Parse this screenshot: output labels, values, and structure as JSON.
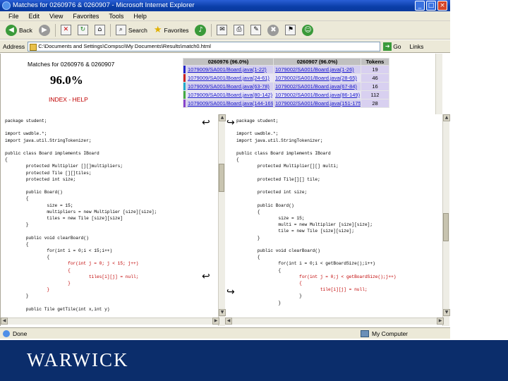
{
  "window": {
    "title": "Matches for 0260976 & 0260907 - Microsoft Internet Explorer",
    "controls": [
      "_",
      "□",
      "×"
    ]
  },
  "menu": [
    "File",
    "Edit",
    "View",
    "Favorites",
    "Tools",
    "Help"
  ],
  "toolbar": {
    "back": "Back",
    "search": "Search",
    "favorites": "Favorites"
  },
  "address": {
    "label": "Address",
    "value": "C:\\Documents and Settings\\Compsci\\My Documents\\Results\\match0.html",
    "go": "Go",
    "links": "Links"
  },
  "header": {
    "title": "Matches for 0260976 & 0260907",
    "percent": "96.0%",
    "index_link": "INDEX - HELP",
    "columns": [
      "0260976 (96.0%)",
      "0260907 (96.0%)",
      "Tokens"
    ],
    "rows": [
      {
        "color": "#2222cc",
        "left": "1079009/SA001/Board.java(1-22)",
        "right": "1079002/SA001/Board.java(1-26)",
        "tokens": "19"
      },
      {
        "color": "#cc2222",
        "left": "1079009/SA001/Board.java(24-61)",
        "right": "1079002/SA001/Board.java(28-65)",
        "tokens": "46"
      },
      {
        "color": "#22aacc",
        "left": "1079009/SA001/Board.java(63-78)",
        "right": "1079002/SA001/Board.java(67-84)",
        "tokens": "16"
      },
      {
        "color": "#44aa44",
        "left": "1079009/SA001/Board.java(80-142)",
        "right": "1079002/SA001/Board.java(86-149)",
        "tokens": "112"
      },
      {
        "color": "#8844cc",
        "left": "1079009/SA001/Board.java(144-169)",
        "right": "1079002/SA001/Board.java(151-175)",
        "tokens": "28"
      }
    ]
  },
  "left_code": [
    "package student;",
    "",
    "import uwdble.*;",
    "import java.util.StringTokenizer;",
    "",
    "public class Board implements IBoard",
    "{",
    "        protected Multiplier [][]multipliers;",
    "        protected Tile [][]tiles;",
    "        protected int size;",
    "",
    "        public Board()",
    "        {",
    "                size = 15;",
    "                multipliers = new Multiplier [size][size];",
    "                tiles = new Tile [size][size]",
    "        }",
    "",
    "        public void clearBoard()",
    "        {",
    "                for(int i = 0;i < 15;i++)",
    "                {",
    "                        for(int j = 0; j < 15; j++)",
    "                        {",
    "                                tiles[i][j] = null;",
    "                        }",
    "                }",
    "        }",
    "",
    "        public Tile getTile(int x,int y)"
  ],
  "right_code": [
    "package student;",
    "",
    "import uwdble.*;",
    "import java.util.StringTokenizer;",
    "",
    "public class Board implements IBoard",
    "{",
    "        protected Multiplier[][] multi;",
    "",
    "        protected Tile[][] tile;",
    "",
    "        protected int size;",
    "",
    "        public Board()",
    "        {",
    "                size = 15;",
    "                multi = new Multiplier [size][size];",
    "                tile = new Tile [size][size];",
    "        }",
    "",
    "        public void clearBoard()",
    "        {",
    "                for(int i = 0;i < getBoardSize();i++)",
    "                {",
    "                        for(int j = 0;j < getBoardSize();j++)",
    "                        {",
    "                                tile[i][j] = null;",
    "                        }",
    "                }"
  ],
  "status": {
    "text": "Done",
    "zone": "My Computer"
  },
  "footer": {
    "logo": "WARWICK"
  }
}
